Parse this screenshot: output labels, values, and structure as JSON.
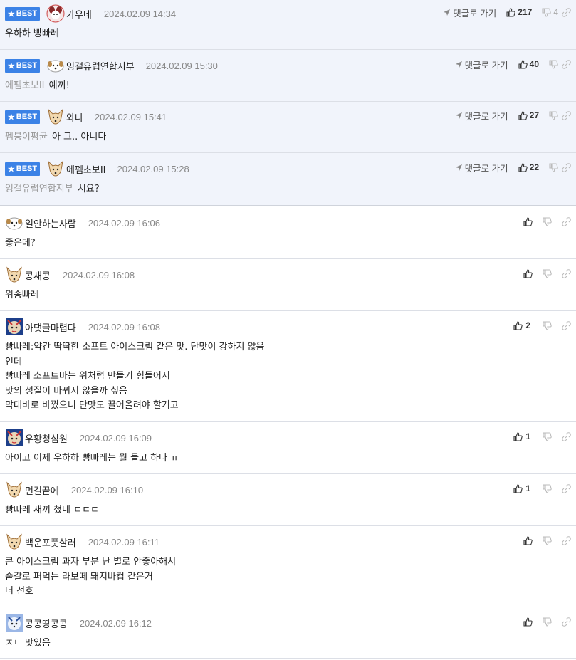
{
  "labels": {
    "best": "BEST",
    "goto_reply": "댓글로 가기"
  },
  "best_comments": [
    {
      "nick": "가우네",
      "date": "2024.02.09 14:34",
      "mention": "",
      "text": "우하하 빵빠레",
      "up": "217",
      "down": "4"
    },
    {
      "nick": "잉갤유럽연합지부",
      "date": "2024.02.09 15:30",
      "mention": "에펨초보II",
      "text": "예끼!",
      "up": "40",
      "down": ""
    },
    {
      "nick": "와나",
      "date": "2024.02.09 15:41",
      "mention": "펨붕이평균",
      "text": "아 그.. 아니다",
      "up": "27",
      "down": ""
    },
    {
      "nick": "에펨초보II",
      "date": "2024.02.09 15:28",
      "mention": "잉갤유럽연합지부",
      "text": "서요?",
      "up": "22",
      "down": ""
    }
  ],
  "comments": [
    {
      "nick": "일안하는사람",
      "date": "2024.02.09 16:06",
      "lines": [
        "좋은데?"
      ],
      "up": ""
    },
    {
      "nick": "콩새콩",
      "date": "2024.02.09 16:08",
      "lines": [
        "위송빠레"
      ],
      "up": ""
    },
    {
      "nick": "아댓글마렵다",
      "date": "2024.02.09 16:08",
      "lines": [
        "빵빠레:약간 딱딱한 소프트 아이스크림 같은 맛. 단맛이 강하지 않음",
        "인데",
        "빵빠레 소프트바는 위처럼 만들기 힘들어서",
        "맛의 성질이 바뀌지 않을까 싶음",
        "막대바로 바꼈으니 단맛도 끌어올려야 할거고"
      ],
      "up": "2"
    },
    {
      "nick": "우황청심원",
      "date": "2024.02.09 16:09",
      "lines": [
        "아이고 이제 우하하 빵빠레는 뭘 들고 하나 ㅠ"
      ],
      "up": "1"
    },
    {
      "nick": "먼길끝에",
      "date": "2024.02.09 16:10",
      "lines": [
        "빵빠레 새끼 쳤네 ㄷㄷㄷ"
      ],
      "up": "1"
    },
    {
      "nick": "백운포풋살러",
      "date": "2024.02.09 16:11",
      "lines": [
        "콘 아이스크림 과자 부분 난 별로 안좋아해서",
        "숟갈로 퍼먹는 라보떼 돼지바컵 같은거",
        "더 선호"
      ],
      "up": ""
    },
    {
      "nick": "콩콩땅콩콩",
      "date": "2024.02.09 16:12",
      "lines": [
        "ㅈㄴ 맛있음"
      ],
      "up": ""
    }
  ],
  "icons": {
    "thumbs_up": "thumbs-up-icon",
    "thumbs_down": "thumbs-down-icon",
    "link": "link-icon",
    "arrow": "send-arrow-icon"
  },
  "colors": {
    "best_badge": "#3b82e6",
    "best_bg": "#f1f4fb",
    "date": "#888888",
    "mention": "#999999"
  }
}
